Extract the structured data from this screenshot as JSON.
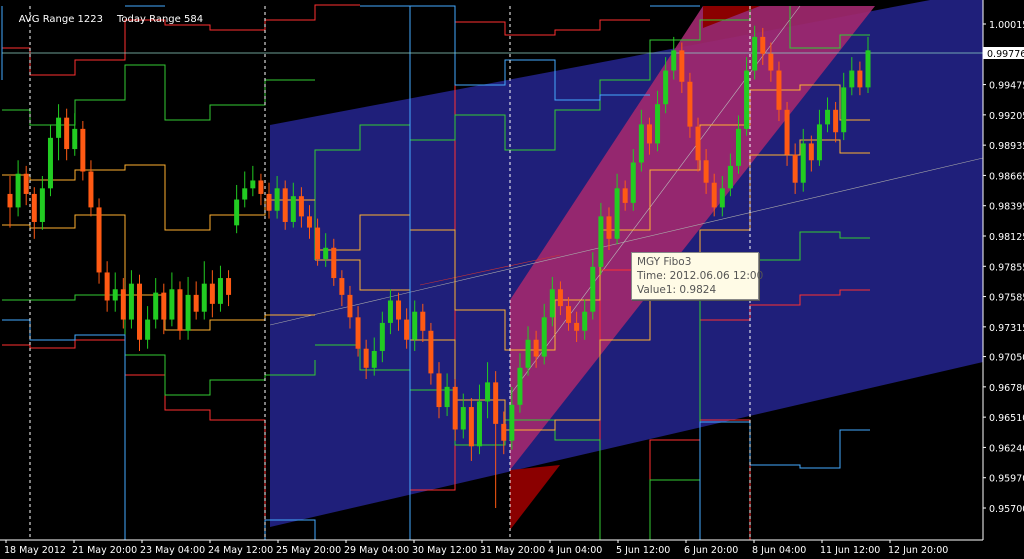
{
  "header": {
    "avg_range": "AVG Range 1223",
    "today_range": "Today Range 584"
  },
  "tooltip": {
    "title": "MGY Fibo3",
    "time": "Time: 2012.06.06 12:00",
    "value": "Value1: 0.9824"
  },
  "colors": {
    "background": "#000000",
    "bull_candle": "#22cc22",
    "bear_candle": "#ff5a14",
    "channel_fill": "#1f1f7a",
    "fibo_band": "#a0286e",
    "fibo_band_dark": "#8b0000",
    "price_line": "#8fd3c7",
    "axis_text": "#ffffff"
  },
  "chart_data": {
    "type": "candlestick",
    "symbol": "",
    "ylim": [
      0.957,
      1.0015
    ],
    "y_ticks": [
      "1.00015",
      "0.99745",
      "0.99475",
      "0.99205",
      "0.98935",
      "0.98665",
      "0.98395",
      "0.98125",
      "0.97855",
      "0.97585",
      "0.97315",
      "0.97050",
      "0.96780",
      "0.96510",
      "0.96240",
      "0.95970",
      "0.95700"
    ],
    "current_price": "0.99776",
    "x_ticks": [
      "18 May 2012",
      "21 May 20:00",
      "23 May 04:00",
      "24 May 12:00",
      "25 May 20:00",
      "29 May 04:00",
      "30 May 12:00",
      "31 May 20:00",
      "4 Jun 04:00",
      "5 Jun 12:00",
      "6 Jun 20:00",
      "8 Jun 04:00",
      "11 Jun 12:00",
      "12 Jun 20:00"
    ],
    "candles": [
      {
        "o": 0.985,
        "c": 0.9838,
        "h": 0.9866,
        "l": 0.982
      },
      {
        "o": 0.9838,
        "c": 0.9868,
        "h": 0.988,
        "l": 0.983
      },
      {
        "o": 0.9868,
        "c": 0.985,
        "h": 0.9875,
        "l": 0.984
      },
      {
        "o": 0.985,
        "c": 0.9825,
        "h": 0.9856,
        "l": 0.981
      },
      {
        "o": 0.9825,
        "c": 0.9855,
        "h": 0.9866,
        "l": 0.9818
      },
      {
        "o": 0.9855,
        "c": 0.99,
        "h": 0.9912,
        "l": 0.9848
      },
      {
        "o": 0.99,
        "c": 0.9918,
        "h": 0.993,
        "l": 0.988
      },
      {
        "o": 0.9918,
        "c": 0.989,
        "h": 0.9926,
        "l": 0.988
      },
      {
        "o": 0.989,
        "c": 0.9908,
        "h": 0.9922,
        "l": 0.9884
      },
      {
        "o": 0.9908,
        "c": 0.987,
        "h": 0.9915,
        "l": 0.9862
      },
      {
        "o": 0.987,
        "c": 0.9838,
        "h": 0.988,
        "l": 0.983
      },
      {
        "o": 0.9838,
        "c": 0.978,
        "h": 0.9846,
        "l": 0.977
      },
      {
        "o": 0.978,
        "c": 0.9755,
        "h": 0.979,
        "l": 0.9745
      },
      {
        "o": 0.9755,
        "c": 0.9765,
        "h": 0.978,
        "l": 0.9745
      },
      {
        "o": 0.9765,
        "c": 0.9738,
        "h": 0.9775,
        "l": 0.973
      },
      {
        "o": 0.9738,
        "c": 0.977,
        "h": 0.9782,
        "l": 0.973
      },
      {
        "o": 0.977,
        "c": 0.972,
        "h": 0.9778,
        "l": 0.971
      },
      {
        "o": 0.972,
        "c": 0.9738,
        "h": 0.975,
        "l": 0.9712
      },
      {
        "o": 0.9738,
        "c": 0.9762,
        "h": 0.9775,
        "l": 0.973
      },
      {
        "o": 0.9762,
        "c": 0.9738,
        "h": 0.977,
        "l": 0.9725
      },
      {
        "o": 0.9738,
        "c": 0.9765,
        "h": 0.978,
        "l": 0.9732
      },
      {
        "o": 0.9765,
        "c": 0.9728,
        "h": 0.9772,
        "l": 0.972
      },
      {
        "o": 0.9728,
        "c": 0.976,
        "h": 0.9776,
        "l": 0.972
      },
      {
        "o": 0.976,
        "c": 0.9745,
        "h": 0.9772,
        "l": 0.9738
      },
      {
        "o": 0.9745,
        "c": 0.977,
        "h": 0.979,
        "l": 0.9738
      },
      {
        "o": 0.977,
        "c": 0.9752,
        "h": 0.9782,
        "l": 0.974
      },
      {
        "o": 0.9752,
        "c": 0.9775,
        "h": 0.9786,
        "l": 0.9745
      },
      {
        "o": 0.9775,
        "c": 0.976,
        "h": 0.9782,
        "l": 0.975
      },
      {
        "o": 0.9822,
        "c": 0.9845,
        "h": 0.9858,
        "l": 0.9815
      },
      {
        "o": 0.9845,
        "c": 0.9855,
        "h": 0.987,
        "l": 0.9838
      },
      {
        "o": 0.9855,
        "c": 0.9862,
        "h": 0.9875,
        "l": 0.9848
      },
      {
        "o": 0.9862,
        "c": 0.985,
        "h": 0.9868,
        "l": 0.984
      },
      {
        "o": 0.985,
        "c": 0.9835,
        "h": 0.986,
        "l": 0.9828
      },
      {
        "o": 0.9835,
        "c": 0.9855,
        "h": 0.9866,
        "l": 0.9828
      },
      {
        "o": 0.9855,
        "c": 0.9825,
        "h": 0.9862,
        "l": 0.9818
      },
      {
        "o": 0.9825,
        "c": 0.9848,
        "h": 0.986,
        "l": 0.982
      },
      {
        "o": 0.9848,
        "c": 0.983,
        "h": 0.9856,
        "l": 0.982
      },
      {
        "o": 0.983,
        "c": 0.982,
        "h": 0.984,
        "l": 0.981
      },
      {
        "o": 0.982,
        "c": 0.9792,
        "h": 0.9828,
        "l": 0.9786
      },
      {
        "o": 0.9792,
        "c": 0.9802,
        "h": 0.9815,
        "l": 0.9785
      },
      {
        "o": 0.9802,
        "c": 0.9775,
        "h": 0.981,
        "l": 0.9768
      },
      {
        "o": 0.9775,
        "c": 0.976,
        "h": 0.9782,
        "l": 0.975
      },
      {
        "o": 0.976,
        "c": 0.974,
        "h": 0.9768,
        "l": 0.973
      },
      {
        "o": 0.974,
        "c": 0.9712,
        "h": 0.975,
        "l": 0.9705
      },
      {
        "o": 0.9712,
        "c": 0.9695,
        "h": 0.972,
        "l": 0.9685
      },
      {
        "o": 0.9695,
        "c": 0.971,
        "h": 0.9722,
        "l": 0.9688
      },
      {
        "o": 0.971,
        "c": 0.9735,
        "h": 0.9745,
        "l": 0.97
      },
      {
        "o": 0.9735,
        "c": 0.9755,
        "h": 0.9765,
        "l": 0.9725
      },
      {
        "o": 0.9755,
        "c": 0.9738,
        "h": 0.9762,
        "l": 0.9728
      },
      {
        "o": 0.9738,
        "c": 0.972,
        "h": 0.9748,
        "l": 0.9712
      },
      {
        "o": 0.972,
        "c": 0.9745,
        "h": 0.9755,
        "l": 0.971
      },
      {
        "o": 0.9745,
        "c": 0.9728,
        "h": 0.9752,
        "l": 0.9718
      },
      {
        "o": 0.9728,
        "c": 0.969,
        "h": 0.9735,
        "l": 0.968
      },
      {
        "o": 0.969,
        "c": 0.966,
        "h": 0.97,
        "l": 0.965
      },
      {
        "o": 0.966,
        "c": 0.9678,
        "h": 0.969,
        "l": 0.9652
      },
      {
        "o": 0.9678,
        "c": 0.964,
        "h": 0.9685,
        "l": 0.963
      },
      {
        "o": 0.964,
        "c": 0.966,
        "h": 0.9672,
        "l": 0.9632
      },
      {
        "o": 0.966,
        "c": 0.9625,
        "h": 0.9668,
        "l": 0.9612
      },
      {
        "o": 0.9625,
        "c": 0.9665,
        "h": 0.968,
        "l": 0.9618
      },
      {
        "o": 0.9665,
        "c": 0.9682,
        "h": 0.97,
        "l": 0.965
      },
      {
        "o": 0.9682,
        "c": 0.9645,
        "h": 0.9692,
        "l": 0.957
      },
      {
        "o": 0.9645,
        "c": 0.963,
        "h": 0.9656,
        "l": 0.9618
      },
      {
        "o": 0.963,
        "c": 0.9662,
        "h": 0.9678,
        "l": 0.9622
      },
      {
        "o": 0.9662,
        "c": 0.9695,
        "h": 0.9708,
        "l": 0.9655
      },
      {
        "o": 0.9695,
        "c": 0.972,
        "h": 0.9732,
        "l": 0.9688
      },
      {
        "o": 0.972,
        "c": 0.9705,
        "h": 0.9728,
        "l": 0.9695
      },
      {
        "o": 0.9705,
        "c": 0.974,
        "h": 0.9752,
        "l": 0.9698
      },
      {
        "o": 0.974,
        "c": 0.9765,
        "h": 0.9776,
        "l": 0.9732
      },
      {
        "o": 0.9765,
        "c": 0.975,
        "h": 0.9772,
        "l": 0.9742
      },
      {
        "o": 0.975,
        "c": 0.9735,
        "h": 0.9758,
        "l": 0.9728
      },
      {
        "o": 0.9735,
        "c": 0.9728,
        "h": 0.9745,
        "l": 0.9718
      },
      {
        "o": 0.9728,
        "c": 0.9745,
        "h": 0.9756,
        "l": 0.972
      },
      {
        "o": 0.9745,
        "c": 0.9785,
        "h": 0.9798,
        "l": 0.9738
      },
      {
        "o": 0.9785,
        "c": 0.983,
        "h": 0.9842,
        "l": 0.9778
      },
      {
        "o": 0.983,
        "c": 0.981,
        "h": 0.9838,
        "l": 0.98
      },
      {
        "o": 0.981,
        "c": 0.9855,
        "h": 0.9868,
        "l": 0.9805
      },
      {
        "o": 0.9855,
        "c": 0.9842,
        "h": 0.9862,
        "l": 0.9835
      },
      {
        "o": 0.9842,
        "c": 0.9878,
        "h": 0.989,
        "l": 0.9835
      },
      {
        "o": 0.9878,
        "c": 0.9912,
        "h": 0.9925,
        "l": 0.987
      },
      {
        "o": 0.9912,
        "c": 0.9895,
        "h": 0.9918,
        "l": 0.9885
      },
      {
        "o": 0.9895,
        "c": 0.993,
        "h": 0.9942,
        "l": 0.9888
      },
      {
        "o": 0.993,
        "c": 0.996,
        "h": 0.9972,
        "l": 0.9922
      },
      {
        "o": 0.996,
        "c": 0.9978,
        "h": 0.999,
        "l": 0.9952
      },
      {
        "o": 0.9978,
        "c": 0.995,
        "h": 0.9985,
        "l": 0.994
      },
      {
        "o": 0.995,
        "c": 0.991,
        "h": 0.9958,
        "l": 0.99
      },
      {
        "o": 0.991,
        "c": 0.988,
        "h": 0.9918,
        "l": 0.987
      },
      {
        "o": 0.988,
        "c": 0.986,
        "h": 0.989,
        "l": 0.985
      },
      {
        "o": 0.986,
        "c": 0.9838,
        "h": 0.9868,
        "l": 0.983
      },
      {
        "o": 0.9838,
        "c": 0.9855,
        "h": 0.9866,
        "l": 0.983
      },
      {
        "o": 0.9855,
        "c": 0.9875,
        "h": 0.9886,
        "l": 0.9848
      },
      {
        "o": 0.9875,
        "c": 0.9908,
        "h": 0.992,
        "l": 0.9868
      },
      {
        "o": 0.9908,
        "c": 0.996,
        "h": 0.9972,
        "l": 0.9902
      },
      {
        "o": 0.996,
        "c": 0.999,
        "h": 1.0,
        "l": 0.9952
      },
      {
        "o": 0.999,
        "c": 0.9975,
        "h": 0.9998,
        "l": 0.9965
      },
      {
        "o": 0.9975,
        "c": 0.996,
        "h": 0.9985,
        "l": 0.995
      },
      {
        "o": 0.996,
        "c": 0.9925,
        "h": 0.9968,
        "l": 0.9915
      },
      {
        "o": 0.9925,
        "c": 0.9885,
        "h": 0.9932,
        "l": 0.9875
      },
      {
        "o": 0.9885,
        "c": 0.986,
        "h": 0.9895,
        "l": 0.985
      },
      {
        "o": 0.986,
        "c": 0.9895,
        "h": 0.9908,
        "l": 0.9852
      },
      {
        "o": 0.9895,
        "c": 0.988,
        "h": 0.9902,
        "l": 0.987
      },
      {
        "o": 0.988,
        "c": 0.9912,
        "h": 0.9925,
        "l": 0.9875
      },
      {
        "o": 0.9912,
        "c": 0.9925,
        "h": 0.9936,
        "l": 0.9905
      },
      {
        "o": 0.9925,
        "c": 0.9905,
        "h": 0.9932,
        "l": 0.9896
      },
      {
        "o": 0.9905,
        "c": 0.9945,
        "h": 0.9958,
        "l": 0.9898
      },
      {
        "o": 0.9945,
        "c": 0.996,
        "h": 0.9972,
        "l": 0.9938
      },
      {
        "o": 0.996,
        "c": 0.9945,
        "h": 0.9968,
        "l": 0.9938
      },
      {
        "o": 0.9945,
        "c": 0.9978,
        "h": 0.999,
        "l": 0.994
      }
    ]
  }
}
